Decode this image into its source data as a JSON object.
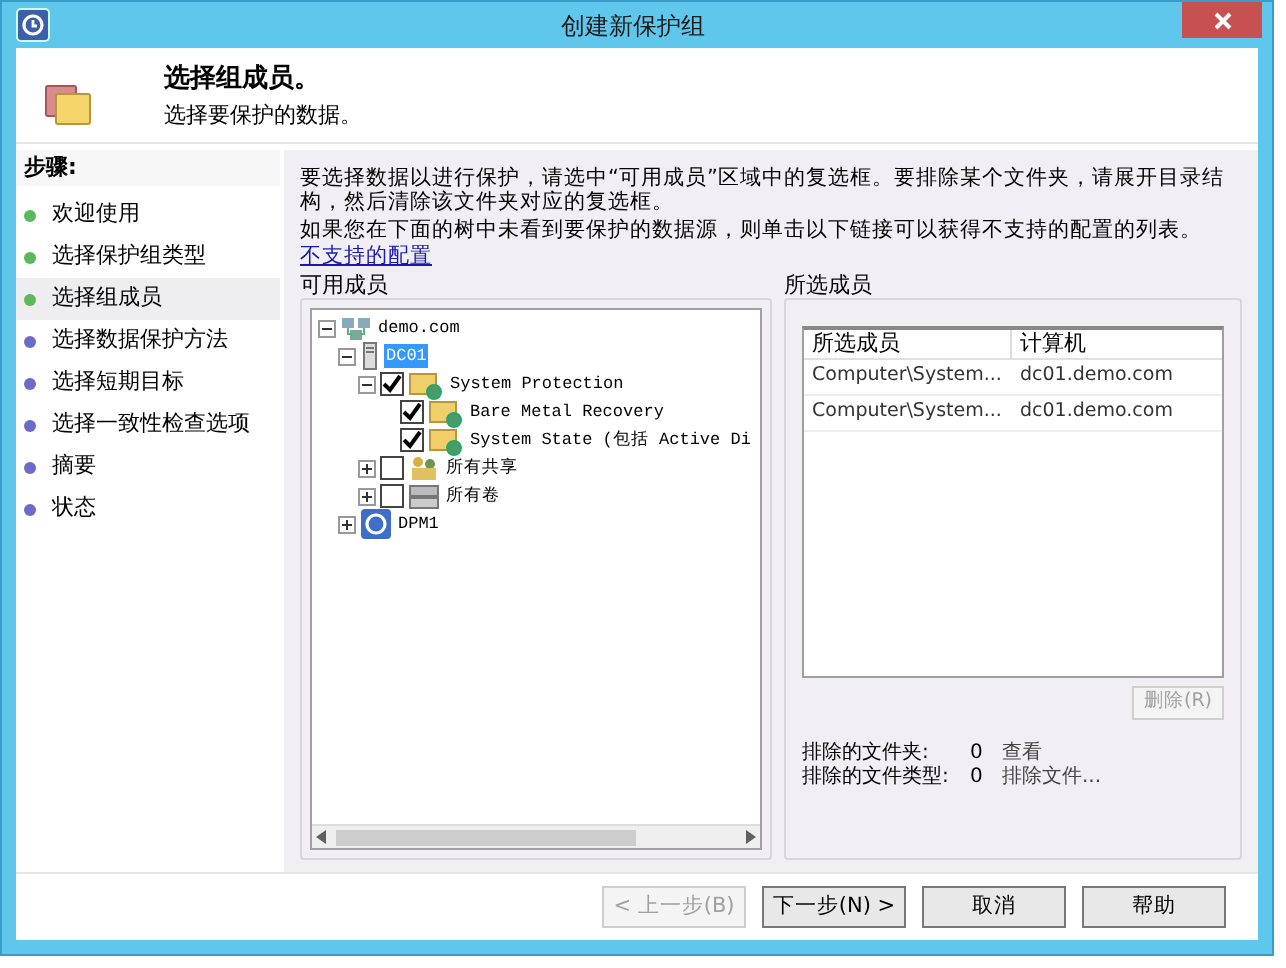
{
  "window": {
    "title": "创建新保护组"
  },
  "header": {
    "title": "选择组成员。",
    "subtitle": "选择要保护的数据。"
  },
  "sidebar": {
    "heading": "步骤:",
    "items": [
      {
        "label": "欢迎使用",
        "completed": true,
        "selected": false
      },
      {
        "label": "选择保护组类型",
        "completed": true,
        "selected": false
      },
      {
        "label": "选择组成员",
        "completed": true,
        "selected": true
      },
      {
        "label": "选择数据保护方法",
        "completed": false,
        "selected": false
      },
      {
        "label": "选择短期目标",
        "completed": false,
        "selected": false
      },
      {
        "label": "选择一致性检查选项",
        "completed": false,
        "selected": false
      },
      {
        "label": "摘要",
        "completed": false,
        "selected": false
      },
      {
        "label": "状态",
        "completed": false,
        "selected": false
      }
    ]
  },
  "instructions": [
    "要选择数据以进行保护，请选中“可用成员”区域中的复选框。要排除某个文件夹，请展开目录结构，然后清除该文件夹对应的复选框。",
    "如果您在下面的树中未看到要保护的数据源，则单击以下链接可以获得不支持的配置的列表。"
  ],
  "link": "不支持的配置",
  "available": {
    "title": "可用成员",
    "tree": [
      {
        "label": "demo.com",
        "kind": "domain",
        "expanded": true,
        "selected": false,
        "children": [
          {
            "label": "DC01",
            "kind": "server",
            "expanded": true,
            "selected": true,
            "children": [
              {
                "label": "System Protection",
                "kind": "protection",
                "expanded": true,
                "checked": true,
                "selected": false,
                "children": [
                  {
                    "label": "Bare Metal Recovery",
                    "kind": "protection",
                    "checked": true,
                    "selected": false
                  },
                  {
                    "label": "System State (包括 Active Di",
                    "kind": "protection",
                    "checked": true,
                    "selected": false
                  }
                ]
              },
              {
                "label": "所有共享",
                "kind": "share",
                "expanded": false,
                "checked": false,
                "selected": false
              },
              {
                "label": "所有卷",
                "kind": "volume",
                "expanded": false,
                "checked": false,
                "selected": false
              }
            ]
          },
          {
            "label": "DPM1",
            "kind": "dpm",
            "expanded": false,
            "selected": false
          }
        ]
      }
    ]
  },
  "selected_members": {
    "title": "所选成员",
    "columns": [
      "所选成员",
      "计算机"
    ],
    "rows": [
      [
        "Computer\\System...",
        "dc01.demo.com"
      ],
      [
        "Computer\\System...",
        "dc01.demo.com"
      ]
    ],
    "remove_button": {
      "label": "删除(R)",
      "disabled": true
    },
    "stats": [
      {
        "label": "排除的文件夹:",
        "value": "0",
        "action": "查看"
      },
      {
        "label": "排除的文件类型:",
        "value": "0",
        "action": "排除文件..."
      }
    ]
  },
  "buttons": [
    {
      "label": "< 上一步(B)",
      "disabled": true
    },
    {
      "label": "下一步(N) >",
      "disabled": false
    },
    {
      "label": "取消",
      "disabled": false
    },
    {
      "label": "帮助",
      "disabled": false
    }
  ]
}
